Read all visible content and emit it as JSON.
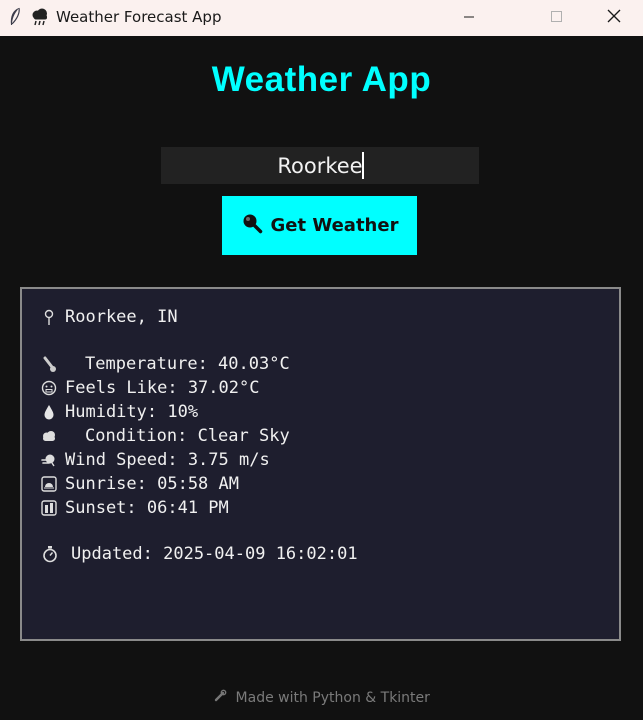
{
  "window": {
    "title": "Weather Forecast App",
    "app_icon": "feather-icon",
    "title_icon": "storm-cloud-icon",
    "controls": [
      "minimize-icon",
      "maximize-icon",
      "close-icon"
    ]
  },
  "header": {
    "title": "Weather App"
  },
  "search": {
    "city_value": "Roorkee",
    "button_label": "Get Weather",
    "button_icon": "magnifier-icon"
  },
  "result": {
    "location": {
      "icon": "pin-icon",
      "text": "Roorkee, IN"
    },
    "rows": [
      {
        "icon": "thermometer-icon",
        "text": "Temperature: 40.03°C"
      },
      {
        "icon": "face-icon",
        "text": "Feels Like: 37.02°C"
      },
      {
        "icon": "droplet-icon",
        "text": "Humidity: 10%"
      },
      {
        "icon": "cloud-icon",
        "text": "Condition: Clear Sky"
      },
      {
        "icon": "wind-icon",
        "text": "Wind Speed: 3.75 m/s"
      },
      {
        "icon": "sunrise-icon",
        "text": "Sunrise: 05:58 AM"
      },
      {
        "icon": "sunset-icon",
        "text": "Sunset: 06:41 PM"
      }
    ],
    "updated": {
      "icon": "stopwatch-icon",
      "text": "Updated: 2025-04-09 16:02:01"
    }
  },
  "footer": {
    "icon": "wrench-icon",
    "text": "Made with Python & Tkinter"
  },
  "colors": {
    "accent": "#00ffff",
    "background": "#111111",
    "panel": "#1e1e2e",
    "panel_border": "#8a8a8a",
    "input_bg": "#222222",
    "titlebar_bg": "#fbf1ef"
  }
}
